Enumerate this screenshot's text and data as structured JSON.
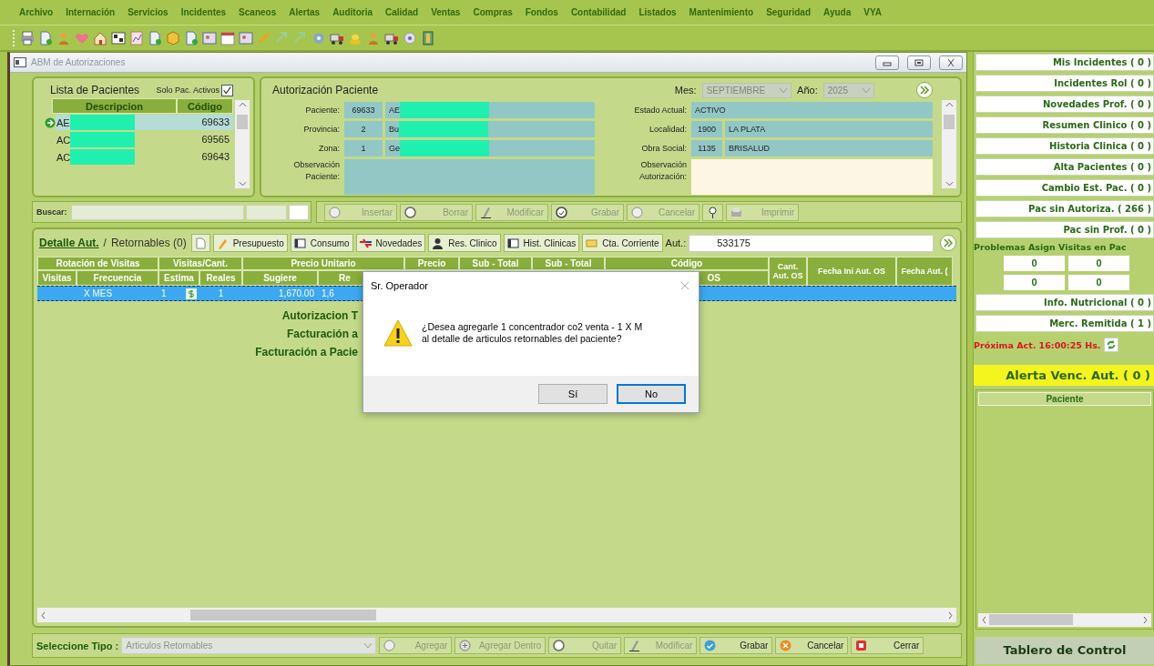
{
  "menu": [
    "Archivo",
    "Internación",
    "Servicios",
    "Incidentes",
    "Scaneos",
    "Alertas",
    "Auditoria",
    "Calidad",
    "Ventas",
    "Compras",
    "Fondos",
    "Contabilidad",
    "Listados",
    "Mantenimiento",
    "Seguridad",
    "Ayuda",
    "VYA"
  ],
  "window": {
    "title": "ABM de Autorizaciones"
  },
  "patients": {
    "title": "Lista de Pacientes",
    "active_only_label": "Solo Pac. Activos",
    "active_only_checked": true,
    "columns": [
      "Descripcion",
      "Código"
    ],
    "rows": [
      {
        "name": "AE",
        "code": "69633",
        "selected": true
      },
      {
        "name": "AC",
        "code": "69565",
        "selected": false
      },
      {
        "name": "AC",
        "code": "69643",
        "selected": false
      }
    ]
  },
  "search": {
    "label": "Buscar:"
  },
  "authorization": {
    "title": "Autorización Paciente",
    "month_label": "Mes:",
    "month": "SEPTIEMBRE",
    "year_label": "Año:",
    "year": "2025",
    "left_fields": [
      {
        "label": "Paciente:",
        "code": "69633",
        "value": "AE"
      },
      {
        "label": "Provincia:",
        "code": "2",
        "value": "Bu"
      },
      {
        "label": "Zona:",
        "code": "1",
        "value": "Ge"
      }
    ],
    "right_fields": [
      {
        "label": "Estado Actual:",
        "value": "ACTIVO"
      },
      {
        "label": "Localidad:",
        "code": "1900",
        "value": "LA PLATA"
      },
      {
        "label": "Obra Social:",
        "code": "1135",
        "value": "BRISALUD"
      }
    ],
    "patient_note_label": "Observación Paciente:",
    "auth_note_label": "Observación Autorización:"
  },
  "actions": [
    {
      "label": "Insertar",
      "disabled": true
    },
    {
      "label": "Borrar",
      "disabled": true
    },
    {
      "label": "Modificar",
      "disabled": true
    },
    {
      "label": "Grabar",
      "disabled": true
    },
    {
      "label": "Cancelar",
      "disabled": true
    },
    {
      "label": "Imprimir",
      "disabled": true
    }
  ],
  "detail": {
    "tabs": [
      {
        "label": "Detalle Aut.",
        "selected": true
      },
      {
        "label": "Retornables (0)",
        "selected": false
      }
    ],
    "buttons": [
      "Presupuesto",
      "Consumo",
      "Novedades",
      "Res. Clinico",
      "Hist. Clinicas",
      "Cta. Corriente"
    ],
    "tab_separator": "/",
    "aut_label": "Aut.:",
    "aut_number": "533175",
    "header_top": [
      "Rotación de Visitas",
      "Visitas/Cant.",
      "Precio Unitario",
      "Precio",
      "Sub - Total",
      "Sub - Total",
      "Código",
      "Cant. Aut. OS",
      "Fecha Ini Aut. OS",
      "Fecha Aut. ("
    ],
    "header_bottom": [
      "Visitas",
      "Frecuencia",
      "Estima",
      "Reales",
      "Sugiere",
      "Re",
      "OS"
    ],
    "rows": [
      {
        "cells": [
          "X MES",
          "1",
          "1",
          "1,670.00",
          "1,6"
        ],
        "selected": true
      }
    ],
    "totals": [
      "Autorizacion T",
      "Facturación a",
      "Facturación a Pacie"
    ]
  },
  "bottom": {
    "type_label": "Seleccione Tipo :",
    "type_value": "Articulos Retornables",
    "buttons": [
      {
        "label": "Agregar",
        "disabled": true
      },
      {
        "label": "Agregar Dentro",
        "disabled": true
      },
      {
        "label": "Quitar",
        "disabled": true
      },
      {
        "label": "Modificar",
        "disabled": true
      },
      {
        "label": "Grabar",
        "disabled": false
      },
      {
        "label": "Cancelar",
        "disabled": false
      },
      {
        "label": "Cerrar",
        "disabled": false
      }
    ]
  },
  "sidebar": {
    "buttons": [
      "Mis Incidentes ( 0 )",
      "Incidentes Rol ( 0 )",
      "Novedades Prof. ( 0 )",
      "Resumen Clinico ( 0 )",
      "Historia Clinica ( 0 )",
      "Alta Pacientes ( 0 )",
      "Cambio Est. Pac. ( 0 )",
      "Pac sin Autoriza. ( 266 )",
      "Pac sin Prof. ( 0 )"
    ],
    "problems_title": "Problemas Asign Visitas en Pac",
    "problem_counts": [
      "0",
      "0",
      "0",
      "0"
    ],
    "buttons_2": [
      "Info. Nutricional ( 0 )",
      "Merc. Remitida ( 1 )"
    ],
    "next_update": "Próxima Act.  16:00:25 Hs.",
    "alert_title": "Alerta Venc. Aut. ( 0 )",
    "alert_columns": [
      "Paciente"
    ],
    "footer": "Tablero de Control"
  },
  "dialog": {
    "title": "Sr. Operador",
    "message_lines": [
      "¿Desea agregarle 1 concentrador co2 venta - 1 X M",
      "al detalle de articulos retornables del paciente?"
    ],
    "buttons": [
      {
        "label": "Sí",
        "selected": false
      },
      {
        "label": "No",
        "selected": true
      }
    ]
  }
}
